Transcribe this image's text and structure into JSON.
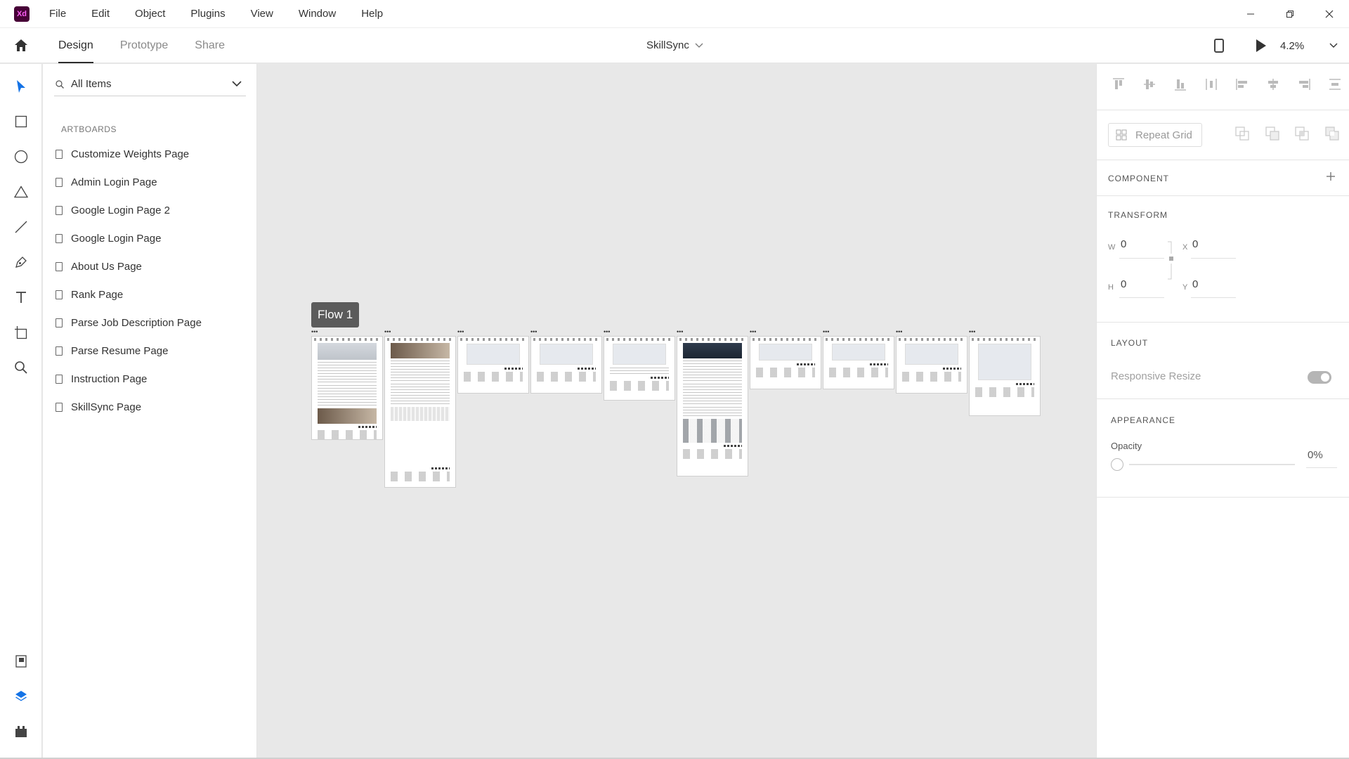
{
  "app": {
    "logo_text": "Xd"
  },
  "menu": [
    "File",
    "Edit",
    "Object",
    "Plugins",
    "View",
    "Window",
    "Help"
  ],
  "tabs": [
    "Design",
    "Prototype",
    "Share"
  ],
  "document": {
    "title": "SkillSync"
  },
  "view": {
    "zoom": "4.2%"
  },
  "layers": {
    "search_label": "All Items",
    "section": "ARTBOARDS",
    "artboards": [
      "Customize Weights Page",
      "Admin Login Page",
      "Google Login Page 2",
      "Google Login Page",
      "About Us Page",
      "Rank Page",
      "Parse Job Description Page",
      "Parse Resume Page",
      "Instruction Page",
      "SkillSync Page"
    ]
  },
  "canvas": {
    "flow_label": "Flow 1",
    "dots": "•••"
  },
  "properties": {
    "repeat_grid": "Repeat Grid",
    "component": "COMPONENT",
    "transform": "TRANSFORM",
    "w_label": "W",
    "w": "0",
    "x_label": "X",
    "x": "0",
    "h_label": "H",
    "h": "0",
    "y_label": "Y",
    "y": "0",
    "layout": "LAYOUT",
    "responsive_resize": "Responsive Resize",
    "responsive_resize_on": true,
    "appearance": "APPEARANCE",
    "opacity_label": "Opacity",
    "opacity": "0%"
  },
  "colors": {
    "accent": "#1473e6",
    "logo_bg": "#470137",
    "logo_fg": "#ff61f6"
  }
}
